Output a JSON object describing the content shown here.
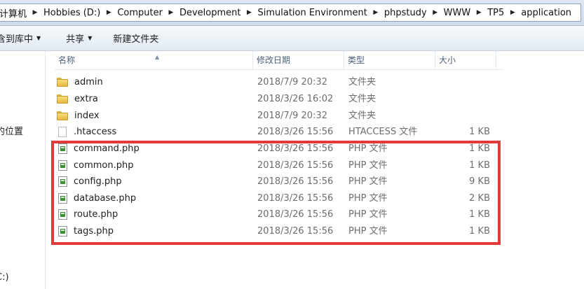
{
  "address_bar": {
    "crumbs": [
      "计算机",
      "Hobbies (D:)",
      "Computer",
      "Development",
      "Simulation Environment",
      "phpstudy",
      "WWW",
      "TP5",
      "application"
    ]
  },
  "toolbar": {
    "include_library": "包含到库中",
    "share": "共享",
    "new_folder": "新建文件夹"
  },
  "nav": {
    "recent_places": "的位置",
    "drive_c": "C:)"
  },
  "columns": {
    "name": "名称",
    "modified": "修改日期",
    "type": "类型",
    "size": "大小"
  },
  "files": [
    {
      "name": "admin",
      "date": "2018/7/9 20:32",
      "type": "文件夹",
      "size": "",
      "icon": "folder-icon"
    },
    {
      "name": "extra",
      "date": "2018/3/26 16:02",
      "type": "文件夹",
      "size": "",
      "icon": "folder-icon"
    },
    {
      "name": "index",
      "date": "2018/7/9 20:32",
      "type": "文件夹",
      "size": "",
      "icon": "folder-icon"
    },
    {
      "name": ".htaccess",
      "date": "2018/3/26 15:56",
      "type": "HTACCESS 文件",
      "size": "1 KB",
      "icon": "blank-file-icon"
    },
    {
      "name": "command.php",
      "date": "2018/3/26 15:56",
      "type": "PHP 文件",
      "size": "1 KB",
      "icon": "php-file-icon"
    },
    {
      "name": "common.php",
      "date": "2018/3/26 15:56",
      "type": "PHP 文件",
      "size": "1 KB",
      "icon": "php-file-icon"
    },
    {
      "name": "config.php",
      "date": "2018/3/26 15:56",
      "type": "PHP 文件",
      "size": "9 KB",
      "icon": "php-file-icon"
    },
    {
      "name": "database.php",
      "date": "2018/3/26 15:56",
      "type": "PHP 文件",
      "size": "2 KB",
      "icon": "php-file-icon"
    },
    {
      "name": "route.php",
      "date": "2018/3/26 15:56",
      "type": "PHP 文件",
      "size": "1 KB",
      "icon": "php-file-icon"
    },
    {
      "name": "tags.php",
      "date": "2018/3/26 15:56",
      "type": "PHP 文件",
      "size": "1 KB",
      "icon": "php-file-icon"
    }
  ],
  "colors": {
    "highlight_border": "#e23a3a"
  }
}
